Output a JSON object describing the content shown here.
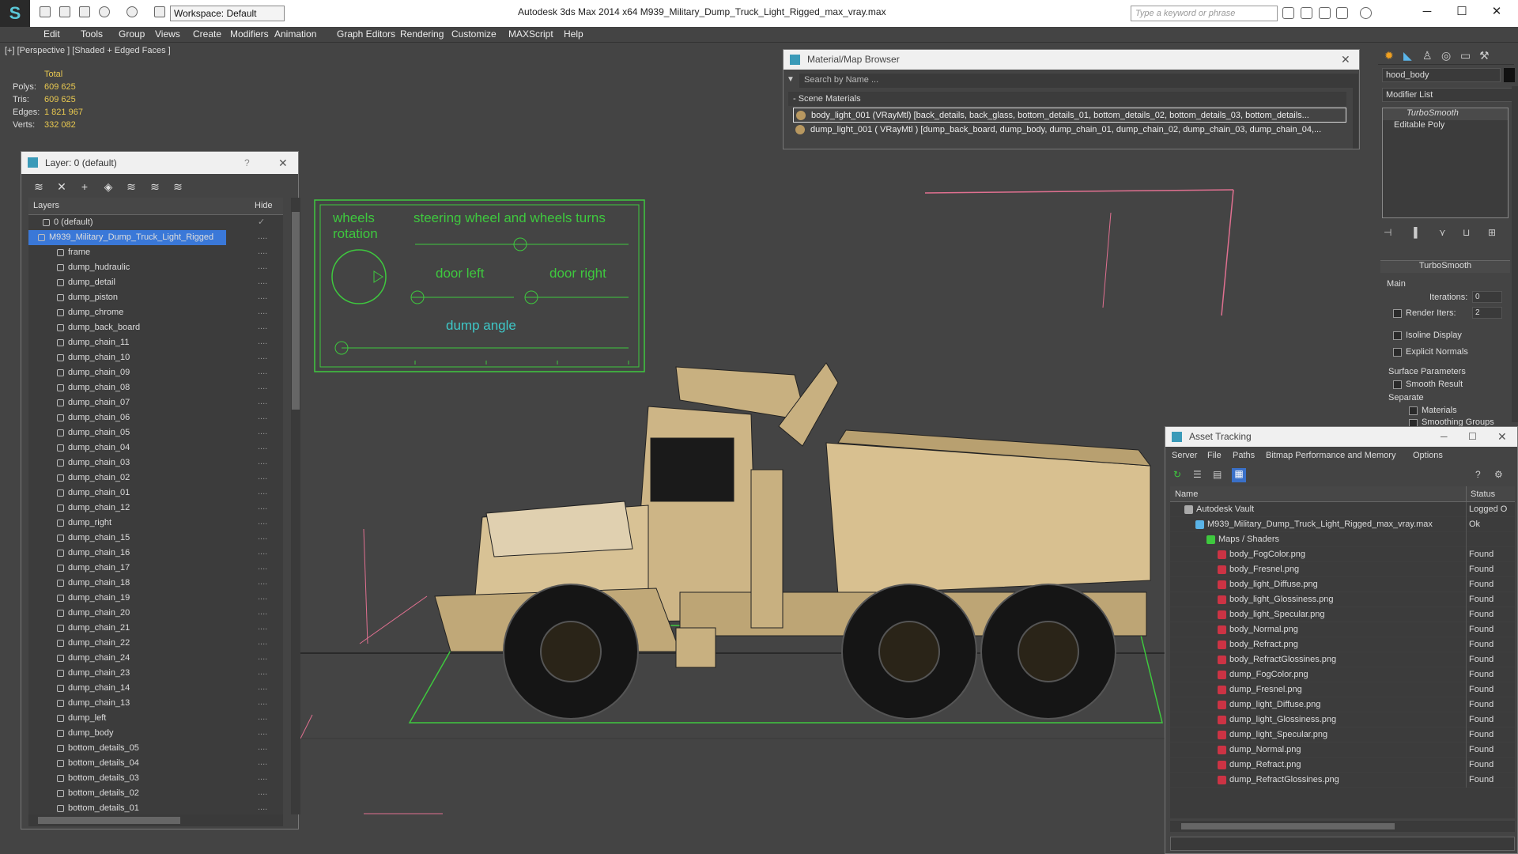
{
  "app": {
    "title": "Autodesk 3ds Max  2014 x64     M939_Military_Dump_Truck_Light_Rigged_max_vray.max",
    "workspace": "Workspace: Default",
    "search_placeholder": "Type a keyword or phrase"
  },
  "menu": [
    "Edit",
    "Tools",
    "Group",
    "Views",
    "Create",
    "Modifiers",
    "Animation",
    "Graph Editors",
    "Rendering",
    "Customize",
    "MAXScript",
    "Help"
  ],
  "viewport": {
    "label": "[+] [Perspective ] [Shaded + Edged Faces ]",
    "stats": {
      "header": "Total",
      "rows": [
        {
          "k": "Polys:",
          "v": "609 625"
        },
        {
          "k": "Tris:",
          "v": "609 625"
        },
        {
          "k": "Edges:",
          "v": "1 821 967"
        },
        {
          "k": "Verts:",
          "v": "332 082"
        }
      ]
    },
    "rig": {
      "wheels_rotation": "wheels\nrotation",
      "steering": "steering wheel and wheels turns",
      "door_left": "door left",
      "door_right": "door right",
      "dump_angle": "dump angle"
    }
  },
  "layer_panel": {
    "title": "Layer: 0 (default)",
    "col_layers": "Layers",
    "col_hide": "Hide",
    "rows": [
      "0 (default)",
      "M939_Military_Dump_Truck_Light_Rigged",
      "frame",
      "dump_hudraulic",
      "dump_detail",
      "dump_piston",
      "dump_chrome",
      "dump_back_board",
      "dump_chain_11",
      "dump_chain_10",
      "dump_chain_09",
      "dump_chain_08",
      "dump_chain_07",
      "dump_chain_06",
      "dump_chain_05",
      "dump_chain_04",
      "dump_chain_03",
      "dump_chain_02",
      "dump_chain_01",
      "dump_chain_12",
      "dump_right",
      "dump_chain_15",
      "dump_chain_16",
      "dump_chain_17",
      "dump_chain_18",
      "dump_chain_19",
      "dump_chain_20",
      "dump_chain_21",
      "dump_chain_22",
      "dump_chain_24",
      "dump_chain_23",
      "dump_chain_14",
      "dump_chain_13",
      "dump_left",
      "dump_body",
      "bottom_details_05",
      "bottom_details_04",
      "bottom_details_03",
      "bottom_details_02",
      "bottom_details_01"
    ]
  },
  "material_browser": {
    "title": "Material/Map Browser",
    "search": "Search by Name ...",
    "section": "- Scene Materials",
    "items": [
      "body_light_001 (VRayMtl) [back_details, back_glass, bottom_details_01, bottom_details_02, bottom_details_03, bottom_details...",
      "dump_light_001  ( VRayMtl ) [dump_back_board, dump_body, dump_chain_01, dump_chain_02, dump_chain_03, dump_chain_04,..."
    ]
  },
  "command_panel": {
    "object_name": "hood_body",
    "modifier_list": "Modifier List",
    "stack": [
      "TurboSmooth",
      "Editable Poly"
    ],
    "rollout": "TurboSmooth",
    "main": "Main",
    "iterations_label": "Iterations:",
    "iterations": "0",
    "render_iters_label": "Render Iters:",
    "render_iters": "2",
    "isoline": "Isoline Display",
    "explicit": "Explicit Normals",
    "surface": "Surface Parameters",
    "smooth": "Smooth Result",
    "separate": "Separate",
    "materials": "Materials",
    "smoothing": "Smoothing Groups"
  },
  "asset_tracking": {
    "title": "Asset Tracking",
    "menu": [
      "Server",
      "File",
      "Paths",
      "Bitmap Performance and Memory",
      "Options"
    ],
    "col_name": "Name",
    "col_status": "Status",
    "rows": [
      {
        "name": "Autodesk Vault",
        "status": "Logged O",
        "indent": 0,
        "icon": "vault"
      },
      {
        "name": "M939_Military_Dump_Truck_Light_Rigged_max_vray.max",
        "status": "Ok",
        "indent": 1,
        "icon": "max"
      },
      {
        "name": "Maps / Shaders",
        "status": "",
        "indent": 2,
        "icon": "folder"
      },
      {
        "name": "body_FogColor.png",
        "status": "Found",
        "indent": 3,
        "icon": "png"
      },
      {
        "name": "body_Fresnel.png",
        "status": "Found",
        "indent": 3,
        "icon": "png"
      },
      {
        "name": "body_light_Diffuse.png",
        "status": "Found",
        "indent": 3,
        "icon": "png"
      },
      {
        "name": "body_light_Glossiness.png",
        "status": "Found",
        "indent": 3,
        "icon": "png"
      },
      {
        "name": "body_light_Specular.png",
        "status": "Found",
        "indent": 3,
        "icon": "png"
      },
      {
        "name": "body_Normal.png",
        "status": "Found",
        "indent": 3,
        "icon": "png"
      },
      {
        "name": "body_Refract.png",
        "status": "Found",
        "indent": 3,
        "icon": "png"
      },
      {
        "name": "body_RefractGlossines.png",
        "status": "Found",
        "indent": 3,
        "icon": "png"
      },
      {
        "name": "dump_FogColor.png",
        "status": "Found",
        "indent": 3,
        "icon": "png"
      },
      {
        "name": "dump_Fresnel.png",
        "status": "Found",
        "indent": 3,
        "icon": "png"
      },
      {
        "name": "dump_light_Diffuse.png",
        "status": "Found",
        "indent": 3,
        "icon": "png"
      },
      {
        "name": "dump_light_Glossiness.png",
        "status": "Found",
        "indent": 3,
        "icon": "png"
      },
      {
        "name": "dump_light_Specular.png",
        "status": "Found",
        "indent": 3,
        "icon": "png"
      },
      {
        "name": "dump_Normal.png",
        "status": "Found",
        "indent": 3,
        "icon": "png"
      },
      {
        "name": "dump_Refract.png",
        "status": "Found",
        "indent": 3,
        "icon": "png"
      },
      {
        "name": "dump_RefractGlossines.png",
        "status": "Found",
        "indent": 3,
        "icon": "png"
      }
    ]
  }
}
